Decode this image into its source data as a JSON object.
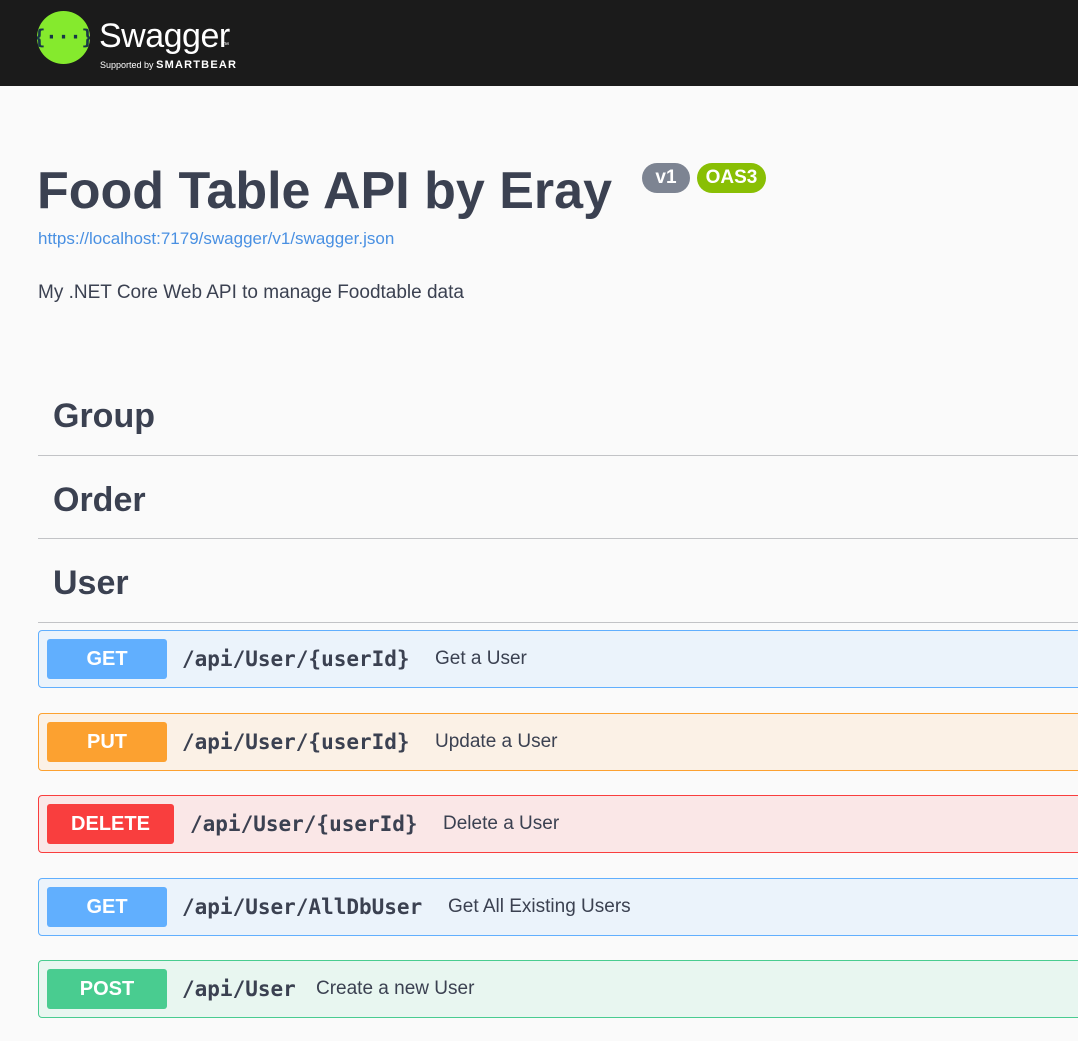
{
  "header": {
    "logo_text": "Swagger",
    "logo_tm": "™",
    "supported_by": "Supported by",
    "brand": "SMARTBEAR",
    "brand_color": "#85ea2d"
  },
  "info": {
    "title": "Food Table API by Eray",
    "version": "v1",
    "spec_version": "OAS3",
    "spec_url": "https://localhost:7179/swagger/v1/swagger.json",
    "description": "My .NET Core Web API to manage Foodtable data"
  },
  "tags": [
    {
      "name": "Group"
    },
    {
      "name": "Order"
    },
    {
      "name": "User"
    }
  ],
  "operations": [
    {
      "method": "GET",
      "path": "/api/User/{userId}",
      "summary": "Get a User",
      "color": "#61affe"
    },
    {
      "method": "PUT",
      "path": "/api/User/{userId}",
      "summary": "Update a User",
      "color": "#fca130"
    },
    {
      "method": "DELETE",
      "path": "/api/User/{userId}",
      "summary": "Delete a User",
      "color": "#f93e3e"
    },
    {
      "method": "GET",
      "path": "/api/User/AllDbUser",
      "summary": "Get All Existing Users",
      "color": "#61affe"
    },
    {
      "method": "POST",
      "path": "/api/User",
      "summary": "Create a new User",
      "color": "#49cc90"
    }
  ]
}
